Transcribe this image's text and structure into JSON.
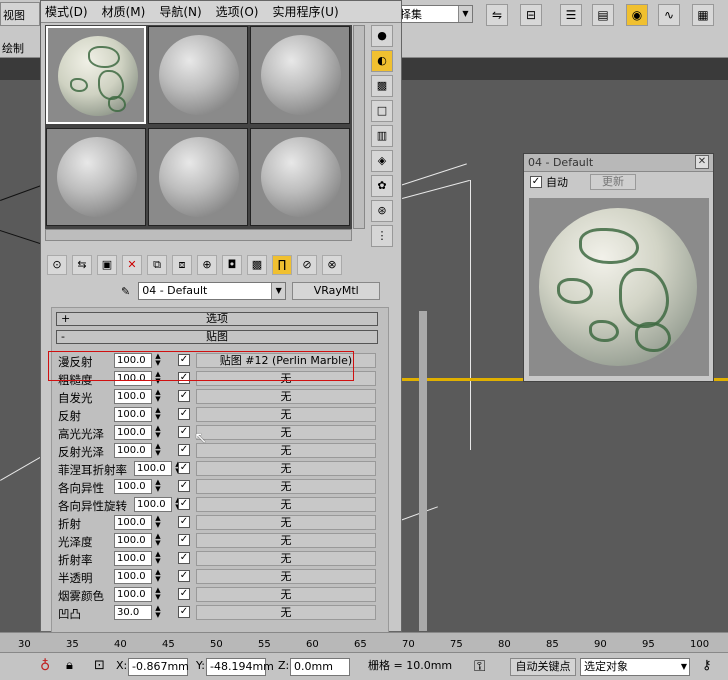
{
  "toolbar": {
    "viewport_label": "视图",
    "select_set_value": "择集",
    "left_sub_label": "绘制"
  },
  "editor": {
    "menu": [
      "模式(D)",
      "材质(M)",
      "导航(N)",
      "选项(O)",
      "实用程序(U)"
    ],
    "material_name": "04 - Default",
    "material_type": "VRayMtl",
    "rollout_options": "选项",
    "rollout_maps": "贴图",
    "rollout_options_sign": "+",
    "rollout_maps_sign": "-",
    "maps": [
      {
        "label": "漫反射",
        "amount": "100.0",
        "checked": "✓",
        "map": "贴图 #12 (Perlin Marble)"
      },
      {
        "label": "粗糙度",
        "amount": "100.0",
        "checked": "✓",
        "map": "无"
      },
      {
        "label": "自发光",
        "amount": "100.0",
        "checked": "✓",
        "map": "无"
      },
      {
        "label": "反射",
        "amount": "100.0",
        "checked": "✓",
        "map": "无"
      },
      {
        "label": "高光光泽",
        "amount": "100.0",
        "checked": "✓",
        "map": "无"
      },
      {
        "label": "反射光泽",
        "amount": "100.0",
        "checked": "✓",
        "map": "无"
      },
      {
        "label": "菲涅耳折射率",
        "amount": "100.0",
        "checked": "✓",
        "map": "无"
      },
      {
        "label": "各向异性",
        "amount": "100.0",
        "checked": "✓",
        "map": "无"
      },
      {
        "label": "各向异性旋转",
        "amount": "100.0",
        "checked": "✓",
        "map": "无"
      },
      {
        "label": "折射",
        "amount": "100.0",
        "checked": "✓",
        "map": "无"
      },
      {
        "label": "光泽度",
        "amount": "100.0",
        "checked": "✓",
        "map": "无"
      },
      {
        "label": "折射率",
        "amount": "100.0",
        "checked": "✓",
        "map": "无"
      },
      {
        "label": "半透明",
        "amount": "100.0",
        "checked": "✓",
        "map": "无"
      },
      {
        "label": "烟雾颜色",
        "amount": "100.0",
        "checked": "✓",
        "map": "无"
      },
      {
        "label": "凹凸",
        "amount": "30.0",
        "checked": "✓",
        "map": "无"
      }
    ]
  },
  "preview": {
    "title": "04 - Default",
    "auto_label": "自动",
    "auto_checked": "✓",
    "update_label": "更新"
  },
  "ruler": {
    "ticks": [
      "30",
      "35",
      "40",
      "45",
      "50",
      "55",
      "60",
      "65",
      "70",
      "75",
      "80",
      "85",
      "90",
      "95",
      "100"
    ]
  },
  "status": {
    "x_label": "X:",
    "x_value": "-0.867mm",
    "y_label": "Y:",
    "y_value": "-48.194mm",
    "z_label": "Z:",
    "z_value": "0.0mm",
    "grid_text": "栅格 = 10.0mm",
    "auto_key_label": "自动关键点",
    "selection_value": "选定对象"
  },
  "colors": {
    "accent": "#f0c030",
    "highlight_box": "#d01010",
    "viewport_border": "#e0b000"
  }
}
